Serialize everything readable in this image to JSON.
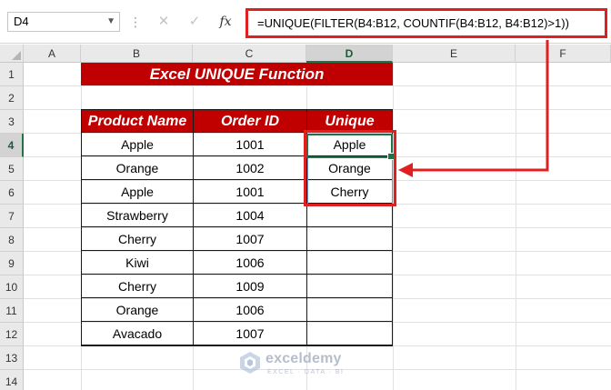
{
  "formula_bar": {
    "name_box": "D4",
    "separator": "⋮",
    "cancel": "✕",
    "enter": "✓",
    "fx_label": "fx",
    "formula": "=UNIQUE(FILTER(B4:B12, COUNTIF(B4:B12, B4:B12)>1))"
  },
  "columns": [
    "A",
    "B",
    "C",
    "D",
    "E",
    "F"
  ],
  "selected_column": "D",
  "rows": [
    "1",
    "2",
    "3",
    "4",
    "5",
    "6",
    "7",
    "8",
    "9",
    "10",
    "11",
    "12",
    "13",
    "14"
  ],
  "selected_row": "4",
  "sheet": {
    "title": "Excel UNIQUE Function",
    "headers": [
      "Product Name",
      "Order ID",
      "Unique"
    ],
    "data": [
      [
        "Apple",
        "1001",
        "Apple"
      ],
      [
        "Orange",
        "1002",
        "Orange"
      ],
      [
        "Apple",
        "1001",
        "Cherry"
      ],
      [
        "Strawberry",
        "1004",
        ""
      ],
      [
        "Cherry",
        "1007",
        ""
      ],
      [
        "Kiwi",
        "1006",
        ""
      ],
      [
        "Cherry",
        "1009",
        ""
      ],
      [
        "Orange",
        "1006",
        ""
      ],
      [
        "Avacado",
        "1007",
        ""
      ]
    ]
  },
  "watermark": {
    "name": "exceldemy",
    "tagline": "EXCEL · DATA · BI"
  },
  "colors": {
    "header_red": "#c00000",
    "highlight_red": "#e02020",
    "selection_green": "#217346",
    "spill_blue": "#5b9bd5"
  }
}
